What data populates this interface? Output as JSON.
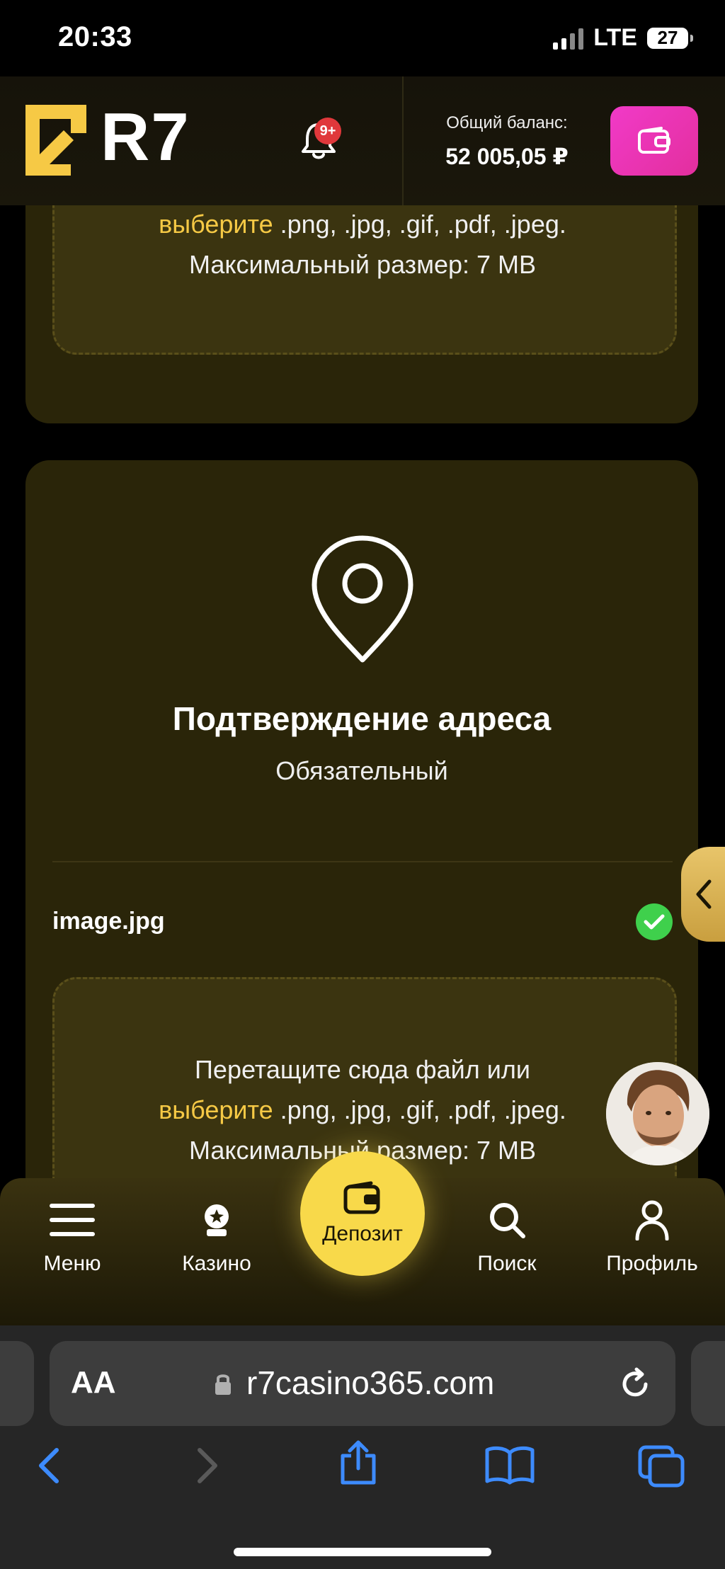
{
  "status_bar": {
    "time": "20:33",
    "network": "LTE",
    "battery": "27"
  },
  "header": {
    "logo_text": "R7",
    "notification_badge": "9+",
    "balance_label": "Общий баланс:",
    "balance_value": "52 005,05 ₽"
  },
  "upload_top": {
    "select_link": "выберите",
    "formats": " .png, .jpg, .gif, .pdf, .jpeg.",
    "max_size": "Максимальный размер: 7 MB"
  },
  "address_card": {
    "title": "Подтверждение адреса",
    "subtitle": "Обязательный",
    "file_name": "image.jpg",
    "drop_text": "Перетащите сюда файл или",
    "select_link": "выберите",
    "formats": " .png, .jpg, .gif, .pdf, .jpeg.",
    "max_size": "Максимальный размер: 7 MB"
  },
  "bottom_nav": {
    "menu": "Меню",
    "casino": "Казино",
    "deposit": "Депозит",
    "search": "Поиск",
    "profile": "Профиль"
  },
  "browser": {
    "aa": "AA",
    "url": "r7casino365.com"
  },
  "colors": {
    "accent_yellow": "#f6c945",
    "wallet_pink": "#e32f9e",
    "card_bg": "#2a2509",
    "safari_blue": "#3d8bfd"
  },
  "icons": [
    "bell-icon",
    "wallet-icon",
    "location-pin-icon",
    "check-icon",
    "chevron-left-icon",
    "menu-icon",
    "casino-icon",
    "search-icon",
    "profile-icon",
    "lock-icon",
    "reload-icon",
    "back-icon",
    "forward-icon",
    "share-icon",
    "bookmarks-icon",
    "tabs-icon"
  ]
}
